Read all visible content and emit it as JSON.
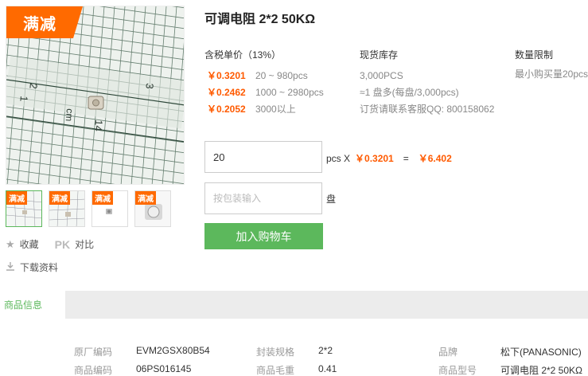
{
  "product": {
    "title": "可调电阻 2*2 50KΩ",
    "badge": "满减"
  },
  "thumbnails": [
    {
      "badge": "满减",
      "active": true
    },
    {
      "badge": "满减",
      "active": false
    },
    {
      "badge": "满减",
      "active": false
    },
    {
      "badge": "满减",
      "active": false
    }
  ],
  "ruler_labels": [
    "2",
    "1",
    "3",
    "14",
    "cm"
  ],
  "actions": {
    "favorite": "收藏",
    "pk": "PK",
    "compare": "对比",
    "download": "下载资料"
  },
  "pricing": {
    "header": "含税单价（13%）",
    "rows": [
      {
        "price": "￥0.3201",
        "qty": "20 ~ 980pcs"
      },
      {
        "price": "￥0.2462",
        "qty": "1000 ~ 2980pcs"
      },
      {
        "price": "￥0.2052",
        "qty": "3000以上"
      }
    ]
  },
  "stock": {
    "header": "现货库存",
    "lines": [
      "3,000PCS",
      "≈1 盘多(每盘/3,000pcs)",
      "订货请联系客服QQ: 800158062"
    ]
  },
  "limit": {
    "header": "数量限制",
    "text": "最小购买量20pcs"
  },
  "order": {
    "qty_value": "20",
    "unit": "pcs X",
    "unit_price": "￥0.3201",
    "equals": "=",
    "total": "￥6.402",
    "pack_placeholder": "按包装输入",
    "pack_unit": "盘",
    "add_to_cart": "加入购物车"
  },
  "tabs": {
    "active": "商品信息"
  },
  "info": {
    "rows": [
      [
        {
          "label": "原厂编码",
          "value": "EVM2GSX80B54"
        },
        {
          "label": "封装规格",
          "value": "2*2"
        },
        {
          "label": "品牌",
          "value": "松下(PANASONIC)"
        }
      ],
      [
        {
          "label": "商品编码",
          "value": "06PS016145"
        },
        {
          "label": "商品毛重",
          "value": "0.41"
        },
        {
          "label": "商品型号",
          "value": "可调电阻 2*2 50KΩ"
        }
      ]
    ]
  },
  "colors": {
    "accent": "#ff6a00",
    "price": "#ff5a00",
    "green": "#5cb85c"
  }
}
